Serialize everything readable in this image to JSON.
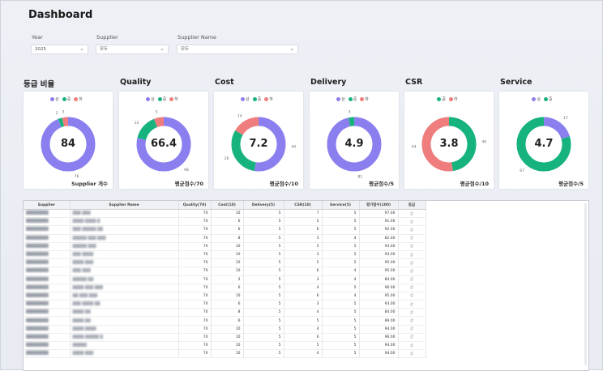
{
  "title": "Dashboard",
  "filters": {
    "year": {
      "label": "Year",
      "value": "2025"
    },
    "supplier": {
      "label": "Supplier",
      "value": "모두"
    },
    "supplier_name": {
      "label": "Supplier Name",
      "value": "모두"
    }
  },
  "legend_labels": {
    "a": "상",
    "b": "중",
    "c": "하"
  },
  "colors": {
    "a": "#8b7ff0",
    "b": "#17b37e",
    "c": "#ef7d7d"
  },
  "cards": [
    {
      "title": "등급 비율",
      "value": "84",
      "bottom": "Supplier 개수",
      "legend": [
        "a",
        "b",
        "c"
      ],
      "slices": [
        {
          "k": "a",
          "v": 76
        },
        {
          "k": "b",
          "v": 2
        },
        {
          "k": "c",
          "v": 3
        }
      ],
      "labels": [
        "76",
        "2",
        "3"
      ]
    },
    {
      "title": "Quality",
      "value": "66.4",
      "bottom": "평균점수/70",
      "legend": [
        "a",
        "b",
        "c"
      ],
      "slices": [
        {
          "k": "a",
          "v": 66
        },
        {
          "k": "b",
          "v": 13
        },
        {
          "k": "c",
          "v": 5
        }
      ],
      "labels": [
        "66",
        "13",
        "5"
      ]
    },
    {
      "title": "Cost",
      "value": "7.2",
      "bottom": "평균점수/10",
      "legend": [
        "a",
        "b",
        "c"
      ],
      "slices": [
        {
          "k": "a",
          "v": 44
        },
        {
          "k": "b",
          "v": 26
        },
        {
          "k": "c",
          "v": 14
        }
      ],
      "labels": [
        "44",
        "26",
        "14"
      ]
    },
    {
      "title": "Delivery",
      "value": "4.9",
      "bottom": "평균점수/5",
      "legend": [
        "a",
        "b",
        "c"
      ],
      "slices": [
        {
          "k": "a",
          "v": 81
        },
        {
          "k": "b",
          "v": 3
        },
        {
          "k": "c",
          "v": 0
        }
      ],
      "labels": [
        "81",
        "3",
        ""
      ]
    },
    {
      "title": "CSR",
      "value": "3.8",
      "bottom": "평균점수/10",
      "legend": [
        "b",
        "c"
      ],
      "slices": [
        {
          "k": "b",
          "v": 40
        },
        {
          "k": "c",
          "v": 44
        }
      ],
      "labels": [
        "40",
        "44"
      ]
    },
    {
      "title": "Service",
      "value": "4.7",
      "bottom": "평균점수/5",
      "legend": [
        "a",
        "b"
      ],
      "slices": [
        {
          "k": "a",
          "v": 17
        },
        {
          "k": "b",
          "v": 67
        }
      ],
      "labels": [
        "17",
        "67"
      ]
    }
  ],
  "table": {
    "columns": [
      "Supplier",
      "Supplier Name",
      "Quality(70)",
      "Cost(10)",
      "Delivery(5)",
      "CSR(10)",
      "Service(5)",
      "평가점수(100)",
      "등급"
    ],
    "rows": [
      [
        "████████",
        "▓▓▓ ▓▓▓",
        "70",
        "10",
        "5",
        "7",
        "5",
        "97.00",
        "상"
      ],
      [
        "████████",
        "▓▓▓▓ ▓▓▓▓ ▓",
        "70",
        "6",
        "5",
        "5",
        "5",
        "91.00",
        "상"
      ],
      [
        "████████",
        "▓▓▓ ▓▓▓▓▓ ▓▓",
        "70",
        "6",
        "5",
        "6",
        "5",
        "92.00",
        "상"
      ],
      [
        "████████",
        "▓▓▓▓▓ ▓▓▓ ▓▓▓",
        "70",
        "8",
        "5",
        "3",
        "4",
        "82.00",
        "상"
      ],
      [
        "████████",
        "▓▓▓▓▓ ▓▓▓",
        "70",
        "10",
        "5",
        "5",
        "5",
        "93.00",
        "상"
      ],
      [
        "████████",
        "▓▓▓ ▓▓▓▓",
        "70",
        "10",
        "5",
        "3",
        "5",
        "93.00",
        "상"
      ],
      [
        "████████",
        "▓▓▓▓ ▓▓▓",
        "70",
        "10",
        "5",
        "5",
        "5",
        "95.00",
        "상"
      ],
      [
        "████████",
        "▓▓▓ ▓▓▓",
        "70",
        "10",
        "5",
        "6",
        "4",
        "95.00",
        "상"
      ],
      [
        "████████",
        "▓▓▓▓▓ ▓▓",
        "70",
        "2",
        "5",
        "3",
        "4",
        "84.00",
        "상"
      ],
      [
        "████████",
        "▓▓▓▓ ▓▓▓ ▓▓▓",
        "70",
        "6",
        "5",
        "4",
        "5",
        "90.00",
        "상"
      ],
      [
        "████████",
        "▓▓ ▓▓▓ ▓▓▓",
        "70",
        "10",
        "5",
        "6",
        "4",
        "95.00",
        "상"
      ],
      [
        "████████",
        "▓▓▓ ▓▓▓▓ ▓▓",
        "70",
        "6",
        "5",
        "3",
        "5",
        "93.00",
        "상"
      ],
      [
        "████████",
        "▓▓▓▓ ▓▓",
        "70",
        "8",
        "5",
        "4",
        "5",
        "84.00",
        "상"
      ],
      [
        "████████",
        "▓▓▓▓ ▓▓",
        "70",
        "6",
        "5",
        "5",
        "5",
        "89.00",
        "상"
      ],
      [
        "████████",
        "▓▓▓▓ ▓▓▓▓",
        "70",
        "10",
        "5",
        "4",
        "5",
        "94.00",
        "상"
      ],
      [
        "████████",
        "▓▓▓▓ ▓▓▓▓▓ ▓",
        "70",
        "10",
        "5",
        "6",
        "5",
        "96.00",
        "상"
      ],
      [
        "████████",
        "▓▓▓▓▓",
        "70",
        "10",
        "5",
        "5",
        "5",
        "94.00",
        "상"
      ],
      [
        "████████",
        "▓▓▓▓ ▓▓▓",
        "70",
        "10",
        "5",
        "4",
        "5",
        "94.00",
        "상"
      ]
    ]
  }
}
